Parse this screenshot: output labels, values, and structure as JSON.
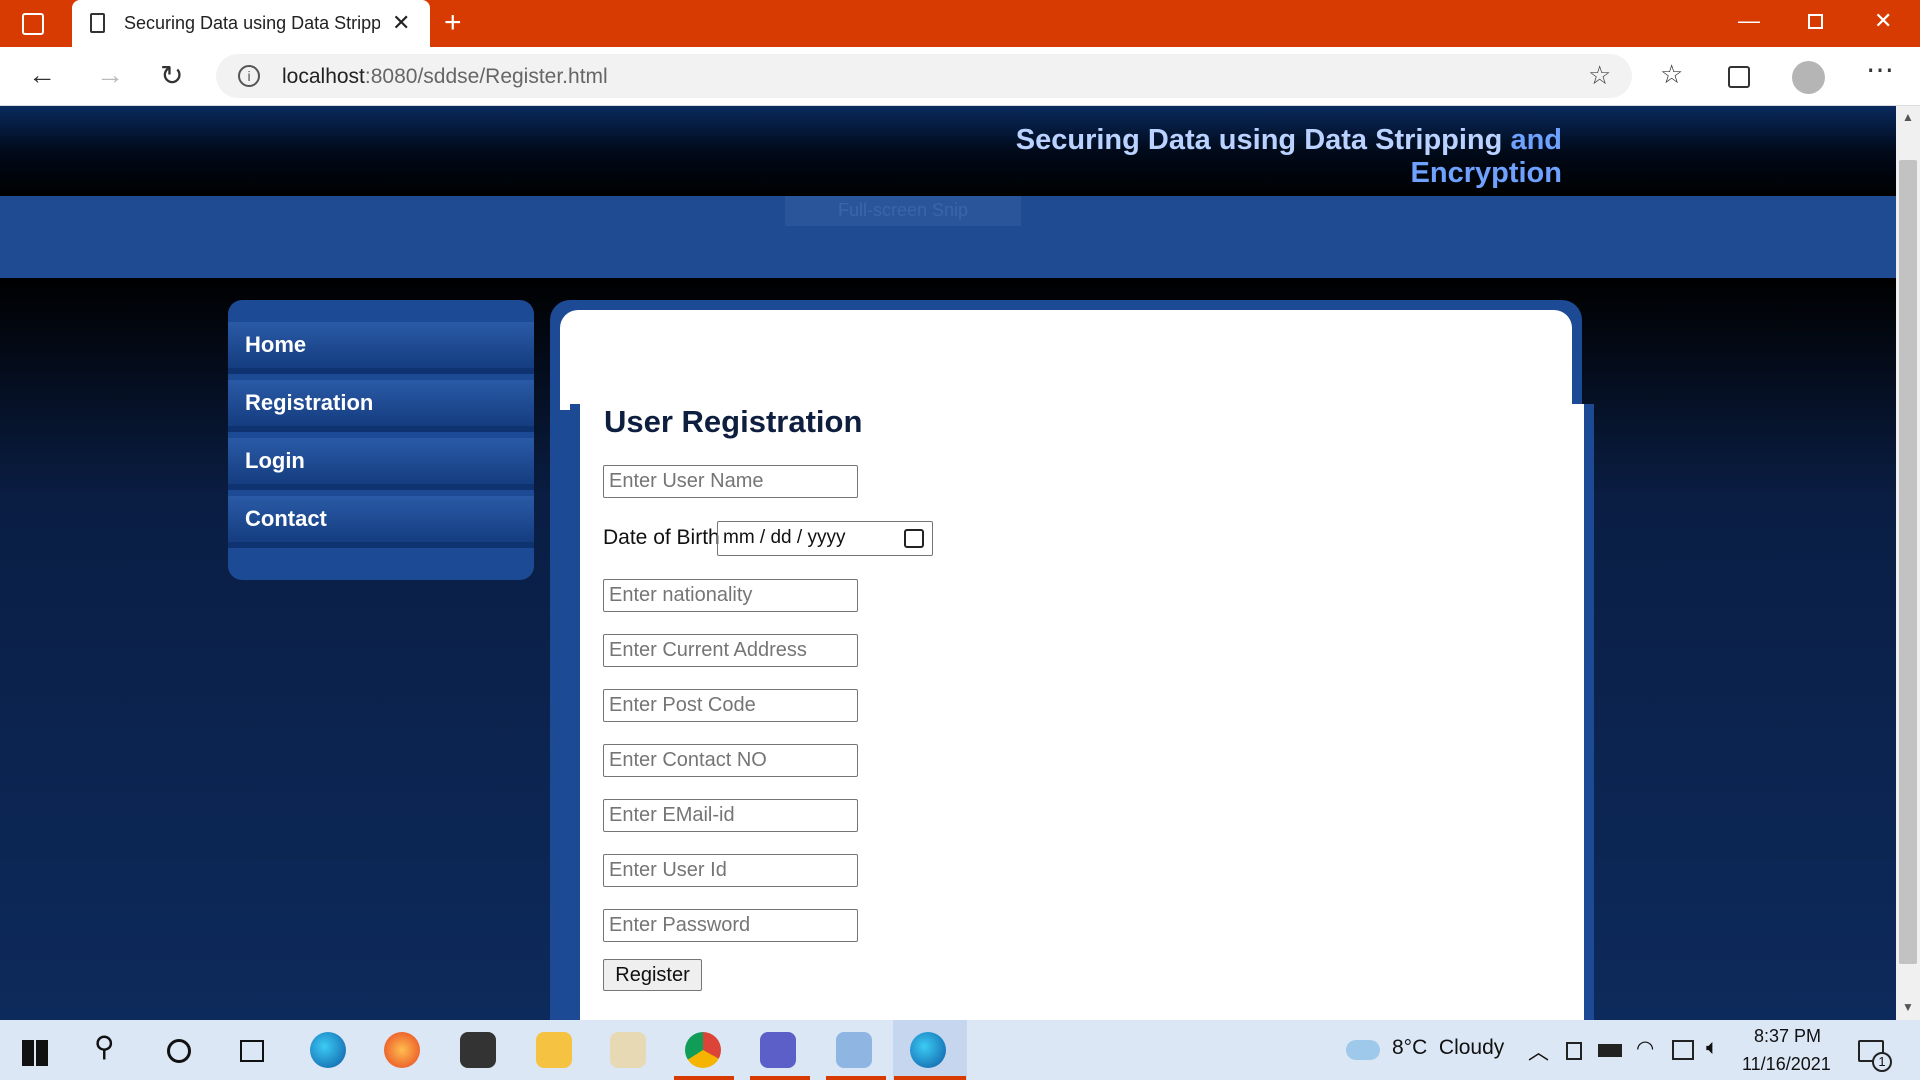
{
  "browser": {
    "tab_title": "Securing Data using Data Stripping and Encryption",
    "new_tab": "+",
    "url_host": "localhost",
    "url_path": ":8080/sddse/Register.html"
  },
  "site": {
    "title_main": "Securing Data using Data Stripping",
    "title_accent_1": "and",
    "title_accent_2": "Encryption",
    "band_ghost": "Full-screen Snip"
  },
  "sidebar": {
    "items": [
      {
        "label": "Home"
      },
      {
        "label": "Registration"
      },
      {
        "label": "Login"
      },
      {
        "label": "Contact"
      }
    ]
  },
  "form": {
    "heading": "User Registration",
    "username_placeholder": "Enter User Name",
    "dob_label": "Date of Birth",
    "dob_value": "mm / dd / yyyy",
    "nationality_placeholder": "Enter nationality",
    "address_placeholder": "Enter Current Address",
    "postcode_placeholder": "Enter Post Code",
    "contact_placeholder": "Enter Contact NO",
    "email_placeholder": "Enter EMail-id",
    "userid_placeholder": "Enter User Id",
    "password_placeholder": "Enter Password",
    "register_label": "Register"
  },
  "taskbar": {
    "weather": "8°C  Cloudy",
    "time": "8:37 PM",
    "date": "11/16/2021",
    "notification_count": "1"
  },
  "colors": {
    "titlebar": "#d83b01",
    "header_text": "#b9d2ff",
    "header_accent": "#6fa1ff",
    "nav_blue": "#1c4a94"
  }
}
